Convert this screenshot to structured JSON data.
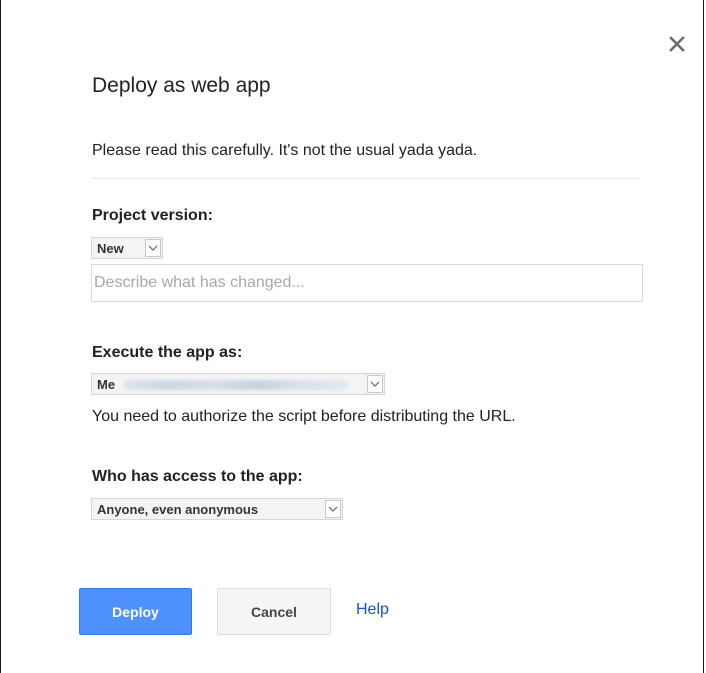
{
  "dialog": {
    "title": "Deploy as web app",
    "warning": "Please read this carefully. It's not the usual yada yada.",
    "close_icon": "close-icon"
  },
  "project_version": {
    "label": "Project version:",
    "selected": "New",
    "description_placeholder": "Describe what has changed...",
    "description_value": ""
  },
  "execute_as": {
    "label": "Execute the app as:",
    "selected": "Me",
    "note": "You need to authorize the script before distributing the URL."
  },
  "access": {
    "label": "Who has access to the app:",
    "selected": "Anyone, even anonymous"
  },
  "buttons": {
    "deploy_label": "Deploy",
    "cancel_label": "Cancel",
    "help_label": "Help"
  },
  "colors": {
    "primary": "#4d90fe",
    "link": "#1155cc"
  }
}
